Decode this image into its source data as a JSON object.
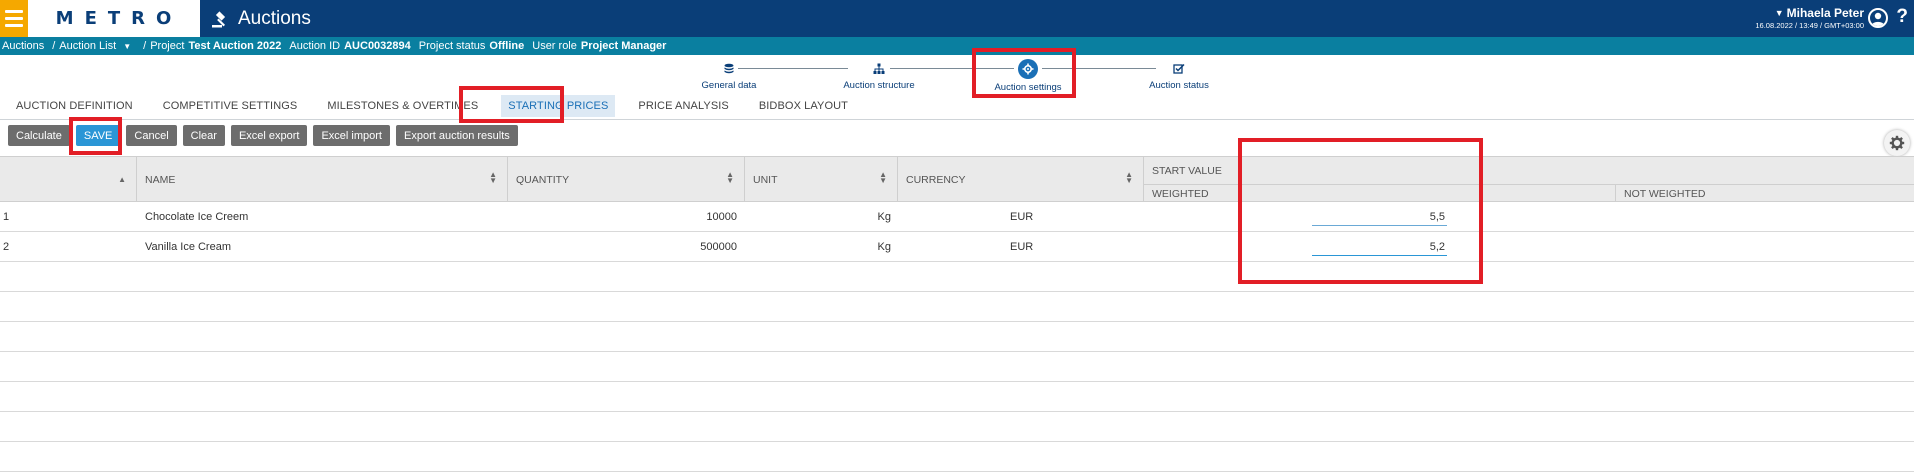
{
  "header": {
    "brand": "METRO",
    "app_title": "Auctions",
    "user_name": "Mihaela Peter",
    "user_datetime": "16.08.2022 / 13:49 / GMT+03:00",
    "help": "?"
  },
  "breadcrumb": {
    "auctions": "Auctions",
    "sep": "/",
    "auction_list": "Auction List",
    "sep2": "/",
    "project_label": "Project",
    "project_value": "Test Auction 2022",
    "auction_id_label": "Auction ID",
    "auction_id_value": "AUC0032894",
    "status_label": "Project status",
    "status_value": "Offline",
    "role_label": "User role",
    "role_value": "Project Manager"
  },
  "stepper": {
    "steps": [
      {
        "label": "General data",
        "icon": "database-icon"
      },
      {
        "label": "Auction structure",
        "icon": "sitemap-icon"
      },
      {
        "label": "Auction settings",
        "icon": "gear-icon"
      },
      {
        "label": "Auction status",
        "icon": "checkbox-icon"
      }
    ],
    "active_index": 2
  },
  "tabs": [
    {
      "label": "AUCTION DEFINITION"
    },
    {
      "label": "COMPETITIVE SETTINGS"
    },
    {
      "label": "MILESTONES & OVERTIMES"
    },
    {
      "label": "STARTING PRICES"
    },
    {
      "label": "PRICE ANALYSIS"
    },
    {
      "label": "BIDBOX LAYOUT"
    }
  ],
  "active_tab_index": 3,
  "toolbar": {
    "calculate": "Calculate",
    "save": "SAVE",
    "cancel": "Cancel",
    "clear": "Clear",
    "excel_export": "Excel export",
    "excel_import": "Excel import",
    "export_results": "Export auction results"
  },
  "grid": {
    "columns": {
      "name": "NAME",
      "quantity": "QUANTITY",
      "unit": "UNIT",
      "currency": "CURRENCY",
      "start_value": "START VALUE",
      "weighted": "WEIGHTED",
      "not_weighted": "NOT WEIGHTED"
    },
    "rows": [
      {
        "no": "1",
        "name": "Chocolate Ice Creem",
        "quantity": "10000",
        "unit": "Kg",
        "currency": "EUR",
        "value": "5,5"
      },
      {
        "no": "2",
        "name": "Vanilla Ice Cream",
        "quantity": "500000",
        "unit": "Kg",
        "currency": "EUR",
        "value": "5,2"
      }
    ]
  },
  "colors": {
    "header_bg": "#0a3e78",
    "breadcrumb_bg": "#0a7fa0",
    "menu_accent": "#f5a800",
    "primary_button": "#2a96d6",
    "annotation_red": "#e21e26"
  }
}
